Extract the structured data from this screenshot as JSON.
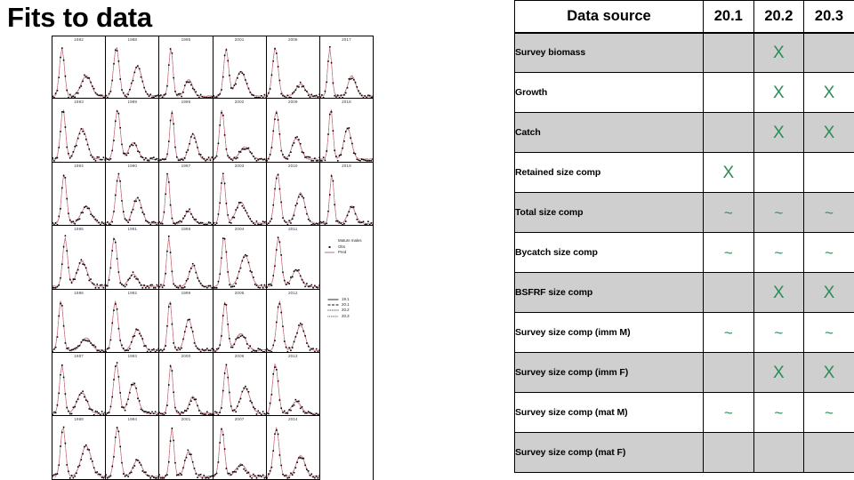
{
  "slide": {
    "title": "Fits to data"
  },
  "figure": {
    "name": "fits-to-data-small-multiples",
    "panel_labels": [
      [
        "1982",
        "1988",
        "1995",
        "2001",
        "2008",
        "2017"
      ],
      [
        "1983",
        "1989",
        "1996",
        "2002",
        "2009",
        "2018"
      ],
      [
        "1984",
        "1990",
        "1997",
        "2003",
        "2010",
        "2019"
      ],
      [
        "1985",
        "1991",
        "1998",
        "2004",
        "2011",
        ""
      ],
      [
        "1986",
        "1992",
        "1999",
        "2005",
        "2012",
        ""
      ],
      [
        "1987",
        "1993",
        "2000",
        "2006",
        "2013",
        ""
      ],
      [
        "1988",
        "1994",
        "2001",
        "2007",
        "2014",
        ""
      ]
    ],
    "legend_obs_pred": {
      "title": "Mature males",
      "items": [
        {
          "label": "Obs",
          "key": "point"
        },
        {
          "label": "Pred",
          "key": "line"
        }
      ]
    },
    "legend_models": {
      "items": [
        {
          "label": "19.1",
          "key": "solid"
        },
        {
          "label": "20.1",
          "key": "dashed"
        },
        {
          "label": "20.2",
          "key": "dotted"
        },
        {
          "label": "20.3",
          "key": "dotdash"
        }
      ]
    },
    "colors": {
      "observed": "#000000",
      "predicted": "#c06c78",
      "panel_border": "#000000",
      "label_text": "#3b3b4d"
    }
  },
  "table": {
    "name": "data-source-model-matrix",
    "columns": [
      "Data source",
      "20.1",
      "20.2",
      "20.3"
    ],
    "marks": {
      "included": "X",
      "approximate": "~",
      "none": ""
    },
    "mark_color": "#2e8b57",
    "shaded_color": "#cfcfcf",
    "rows": [
      {
        "name": "Survey biomass",
        "shaded": true,
        "values": [
          "",
          "X",
          ""
        ]
      },
      {
        "name": "Growth",
        "shaded": false,
        "values": [
          "",
          "X",
          "X"
        ]
      },
      {
        "name": "Catch",
        "shaded": true,
        "values": [
          "",
          "X",
          "X"
        ]
      },
      {
        "name": "Retained size comp",
        "shaded": false,
        "values": [
          "X",
          "",
          ""
        ]
      },
      {
        "name": "Total size comp",
        "shaded": true,
        "values": [
          "~",
          "~",
          "~"
        ]
      },
      {
        "name": "Bycatch size comp",
        "shaded": false,
        "values": [
          "~",
          "~",
          "~"
        ]
      },
      {
        "name": "BSFRF size comp",
        "shaded": true,
        "values": [
          "",
          "X",
          "X"
        ]
      },
      {
        "name": "Survey size comp (imm M)",
        "shaded": false,
        "values": [
          "~",
          "~",
          "~"
        ]
      },
      {
        "name": "Survey size comp (imm F)",
        "shaded": true,
        "values": [
          "",
          "X",
          "X"
        ]
      },
      {
        "name": "Survey size comp (mat M)",
        "shaded": false,
        "values": [
          "~",
          "~",
          "~"
        ]
      },
      {
        "name": "Survey size comp (mat F)",
        "shaded": true,
        "values": [
          "",
          "",
          ""
        ]
      }
    ]
  }
}
